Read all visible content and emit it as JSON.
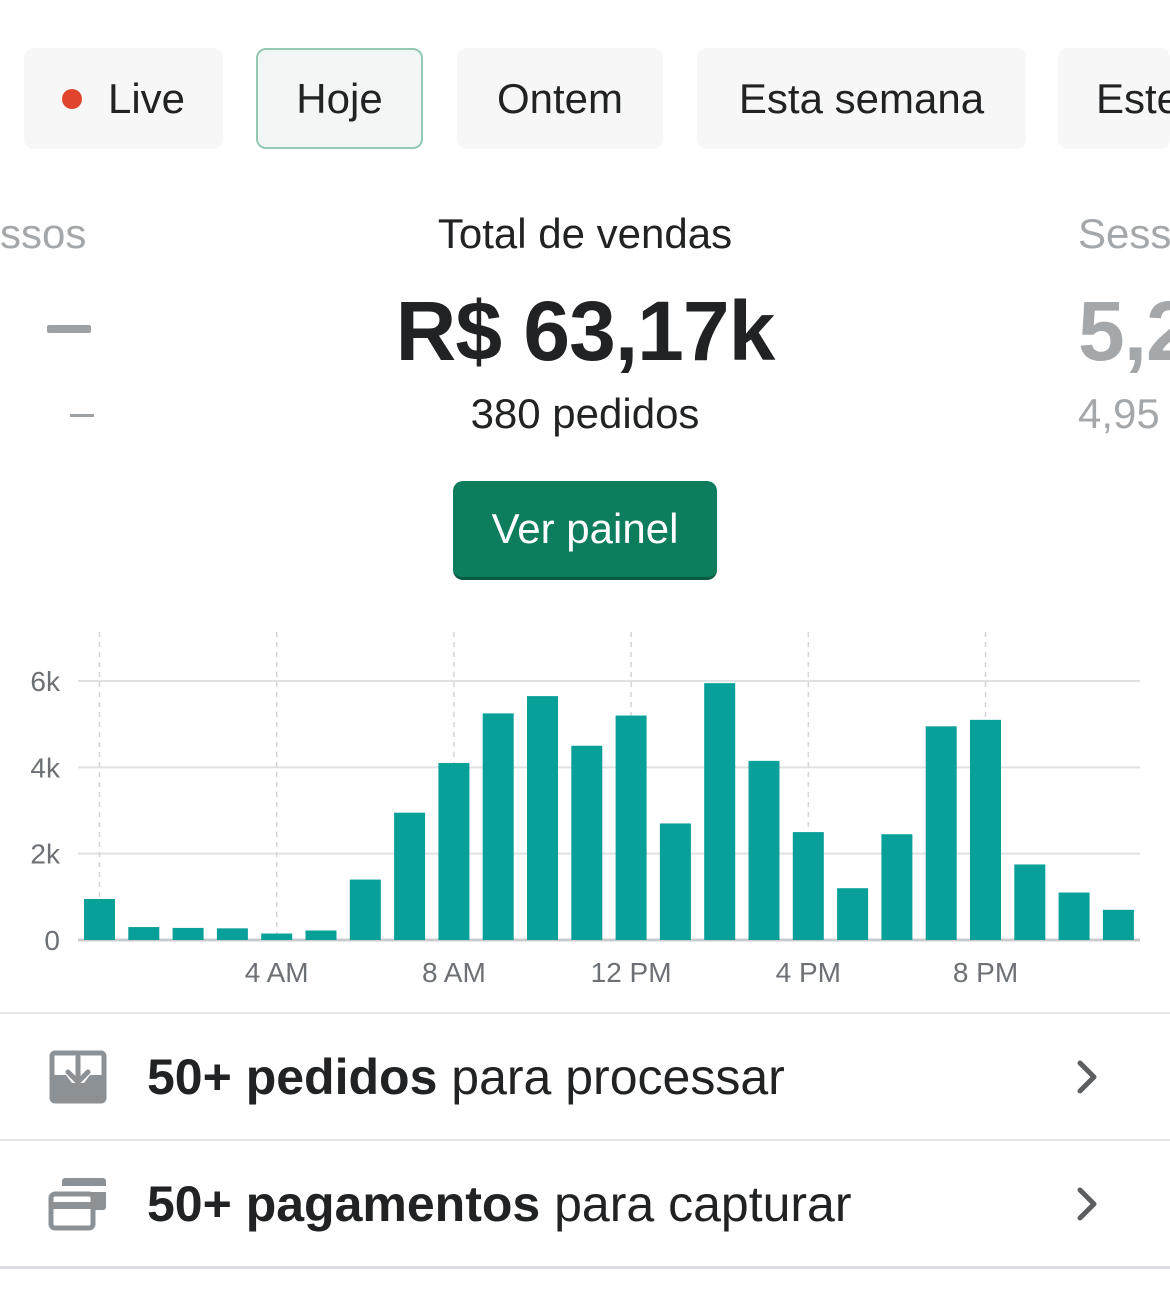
{
  "filters": {
    "live_label": "Live",
    "today_label": "Hoje",
    "yesterday_label": "Ontem",
    "this_week_label": "Esta semana",
    "this_month_partial_label": "Este"
  },
  "metrics": {
    "left_partial_title": "ssos",
    "main": {
      "title": "Total de vendas",
      "value": "R$ 63,17k",
      "subtitle": "380 pedidos"
    },
    "right_partial": {
      "title": "Sess",
      "value": "5,2",
      "subtitle": "4,95"
    }
  },
  "cta": {
    "label": "Ver painel"
  },
  "colors": {
    "bar": "#0aa09a",
    "accent_green": "#0e7d5d",
    "live_dot": "#e0442f"
  },
  "chart_data": {
    "type": "bar",
    "hours": [
      0,
      1,
      2,
      3,
      4,
      5,
      6,
      7,
      8,
      9,
      10,
      11,
      12,
      13,
      14,
      15,
      16,
      17,
      18,
      19,
      20,
      21,
      22,
      23
    ],
    "values": [
      950,
      300,
      280,
      270,
      150,
      220,
      1400,
      2950,
      4100,
      5250,
      5650,
      4500,
      5200,
      2700,
      5950,
      4150,
      2500,
      1200,
      2450,
      4950,
      5100,
      1750,
      1100,
      700
    ],
    "ylim": [
      0,
      6000
    ],
    "yticks": [
      "0",
      "2k",
      "4k",
      "6k"
    ],
    "xticks": [
      "4 AM",
      "8 AM",
      "12 PM",
      "4 PM",
      "8 PM"
    ],
    "grid": true
  },
  "actions": [
    {
      "bold": "50+ pedidos",
      "rest": " para processar",
      "icon": "inbox-download-icon"
    },
    {
      "bold": "50+ pagamentos",
      "rest": " para capturar",
      "icon": "credit-card-icon"
    }
  ]
}
